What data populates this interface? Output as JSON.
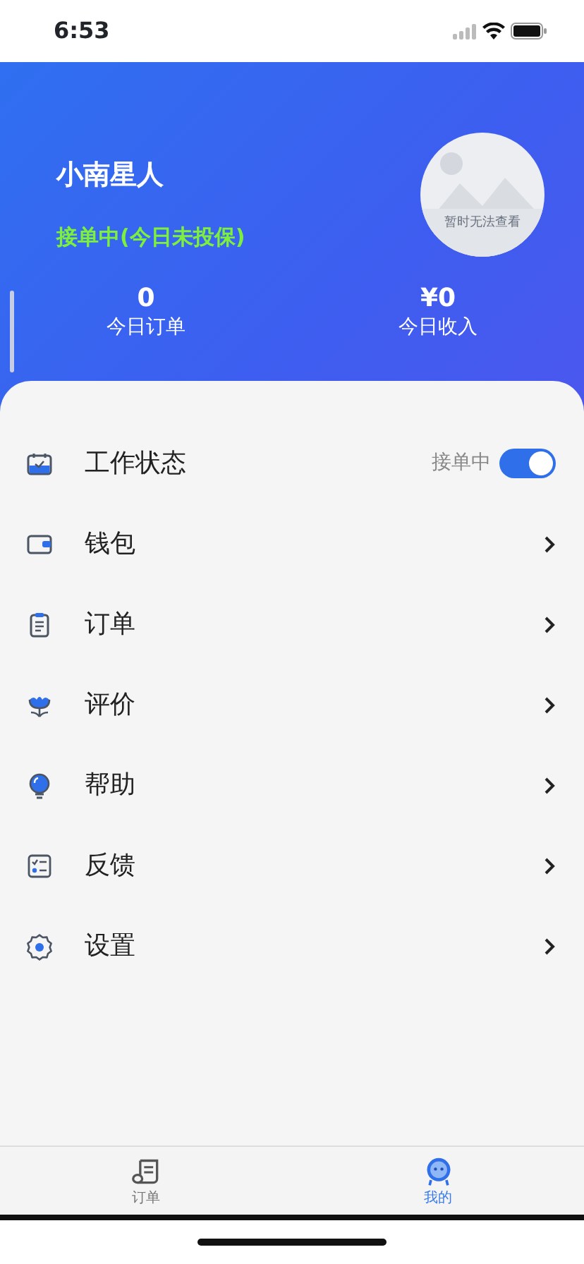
{
  "status_bar": {
    "time": "6:53"
  },
  "profile": {
    "name": "小南星人",
    "status": "接单中(今日未投保)",
    "avatar_caption": "暂时无法查看"
  },
  "stats": [
    {
      "value": "0",
      "label": "今日订单"
    },
    {
      "value": "¥0",
      "label": "今日收入"
    }
  ],
  "menu": [
    {
      "kind": "toggle",
      "label": "工作状态",
      "state_text": "接单中",
      "on": true
    },
    {
      "kind": "link",
      "label": "钱包"
    },
    {
      "kind": "link",
      "label": "订单"
    },
    {
      "kind": "link",
      "label": "评价"
    },
    {
      "kind": "link",
      "label": "帮助"
    },
    {
      "kind": "link",
      "label": "反馈"
    },
    {
      "kind": "link",
      "label": "设置"
    }
  ],
  "tab_bar": [
    {
      "label": "订单",
      "selected": false
    },
    {
      "label": "我的",
      "selected": true
    }
  ]
}
